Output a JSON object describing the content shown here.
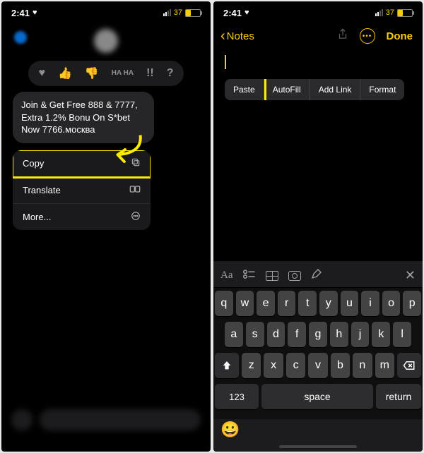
{
  "status": {
    "time": "2:41",
    "battery_pct": "37"
  },
  "left": {
    "bubble_text": "Join & Get Free 888 & 7777, Extra 1.2% Bonu On S*bet Now 7766.москва",
    "reactions": [
      "♥",
      "👍",
      "👎",
      "HA HA",
      "!!",
      "?"
    ],
    "menu": {
      "copy": "Copy",
      "translate": "Translate",
      "more": "More..."
    }
  },
  "right": {
    "back_label": "Notes",
    "done_label": "Done",
    "edit_menu": {
      "paste": "Paste",
      "autofill": "AutoFill",
      "addlink": "Add Link",
      "format": "Format"
    },
    "kbd_toolbar_aa": "Aa",
    "keyboard": {
      "row1": [
        "q",
        "w",
        "e",
        "r",
        "t",
        "y",
        "u",
        "i",
        "o",
        "p"
      ],
      "row2": [
        "a",
        "s",
        "d",
        "f",
        "g",
        "h",
        "j",
        "k",
        "l"
      ],
      "row3": [
        "z",
        "x",
        "c",
        "v",
        "b",
        "n",
        "m"
      ],
      "num_label": "123",
      "space_label": "space",
      "return_label": "return"
    }
  }
}
